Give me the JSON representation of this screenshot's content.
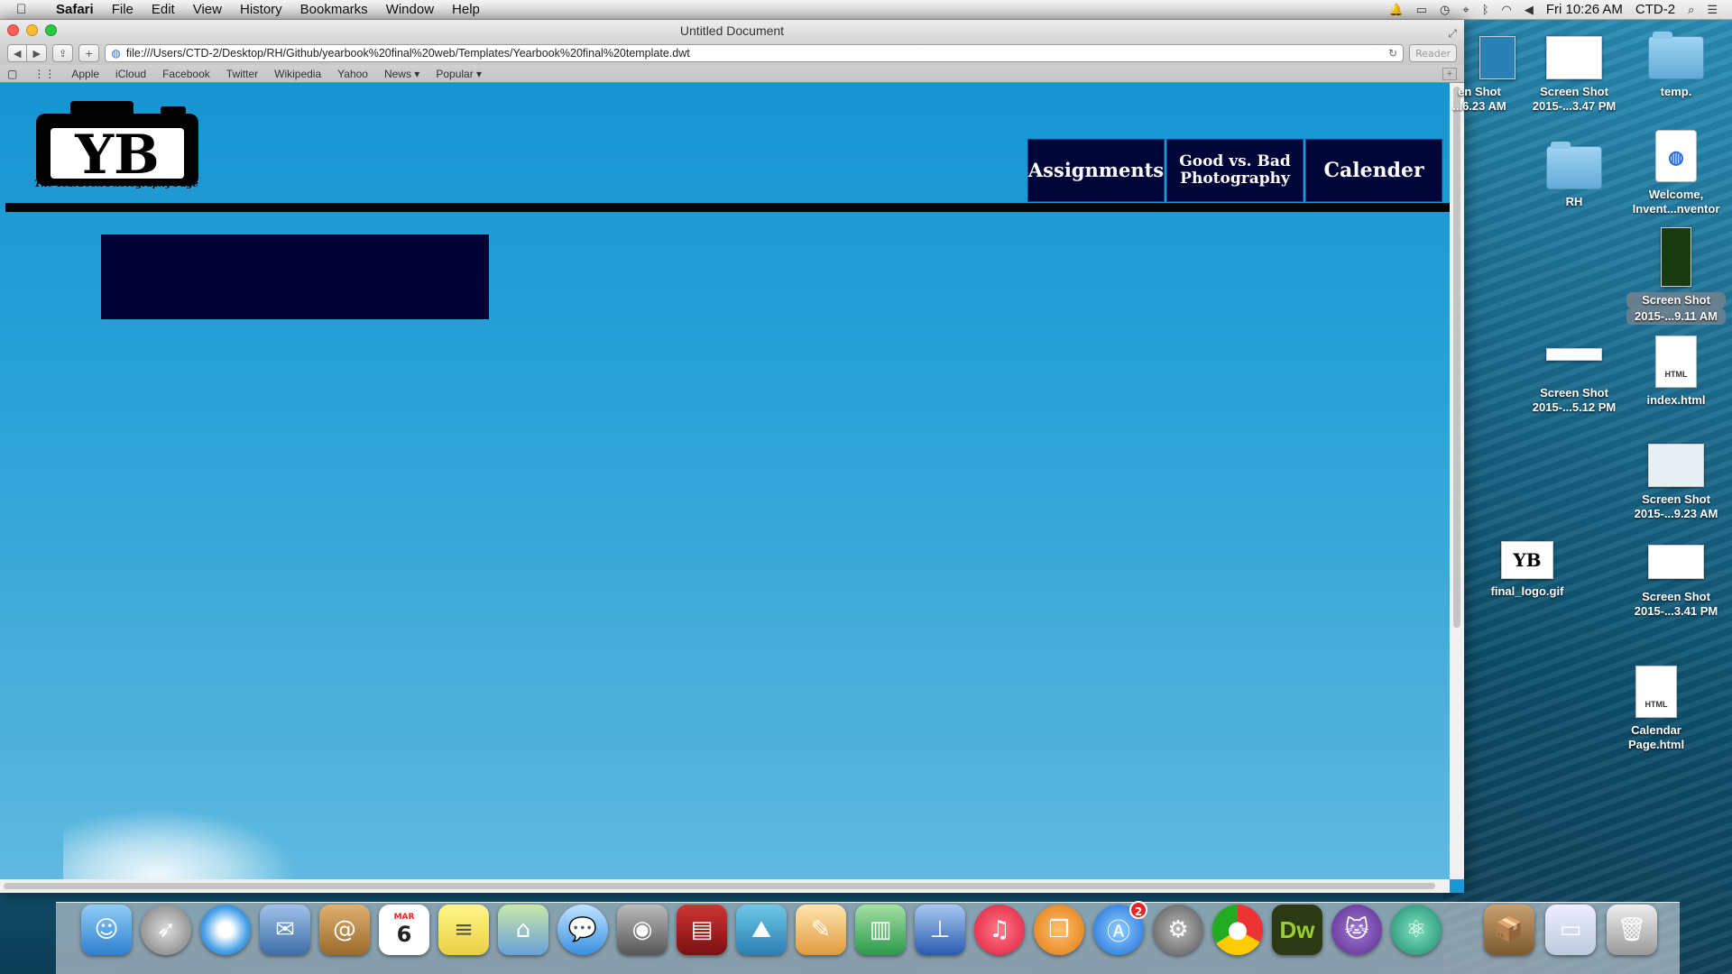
{
  "menubar": {
    "app": "Safari",
    "items": [
      "File",
      "Edit",
      "View",
      "History",
      "Bookmarks",
      "Window",
      "Help"
    ],
    "clock": "Fri 10:26 AM",
    "user": "CTD-2"
  },
  "window": {
    "title": "Untitled Document",
    "url": "file:///Users/CTD-2/Desktop/RH/Github/yearbook%20final%20web/Templates/Yearbook%20final%20template.dwt",
    "reader_label": "Reader",
    "bookmarks": [
      "Apple",
      "iCloud",
      "Facebook",
      "Twitter",
      "Wikipedia",
      "Yahoo",
      "News ▾",
      "Popular ▾"
    ]
  },
  "page": {
    "logo_letters": "YB",
    "logo_caption": "The Yearbook Photography Page",
    "nav": [
      "Assignments",
      "Good vs. Bad Photography",
      "Calender"
    ]
  },
  "desktop": {
    "icons": [
      {
        "name": "en Shot",
        "sub": "...6.23 AM"
      },
      {
        "name": "Screen Shot",
        "sub": "2015-...3.47 PM"
      },
      {
        "name": "temp.",
        "sub": ""
      },
      {
        "name": "RH",
        "sub": ""
      },
      {
        "name": "Welcome,",
        "sub": "Invent...nventor"
      },
      {
        "name": "Screen Shot",
        "sub": "2015-...9.11 AM"
      },
      {
        "name": "Screen Shot",
        "sub": "2015-...5.12 PM"
      },
      {
        "name": "index.html",
        "sub": ""
      },
      {
        "name": "Screen Shot",
        "sub": "2015-...9.23 AM"
      },
      {
        "name": "final_logo.gif",
        "sub": ""
      },
      {
        "name": "Screen Shot",
        "sub": "2015-...3.41 PM"
      },
      {
        "name": "Calendar",
        "sub": "Page.html"
      }
    ],
    "doc_badge": "HTML"
  },
  "dock": {
    "appstore_badge": "2",
    "calendar_month": "MAR",
    "calendar_day": "6",
    "dw_label": "Dw"
  }
}
